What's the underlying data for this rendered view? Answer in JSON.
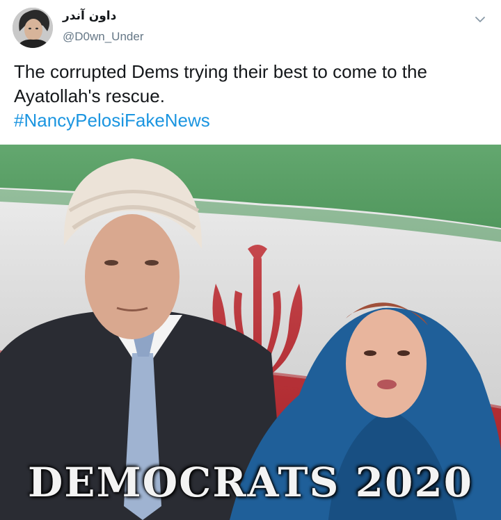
{
  "author": {
    "display_name": "داون آندر",
    "handle": "@D0wn_Under"
  },
  "tweet": {
    "text_line1": "The corrupted Dems trying their best to come to the",
    "text_line2": "Ayatollah's rescue.",
    "hashtag": "#NancyPelosiFakeNews"
  },
  "media": {
    "caption": "DEMOCRATS 2020",
    "flag_colors": {
      "green": "#2f8a3f",
      "white": "#f2f2f2",
      "red": "#c8262d"
    }
  },
  "icons": {
    "menu": "chevron-down-icon",
    "avatar": "user-avatar"
  },
  "colors": {
    "link": "#1b95e0",
    "text": "#14171a",
    "muted": "#657786"
  }
}
